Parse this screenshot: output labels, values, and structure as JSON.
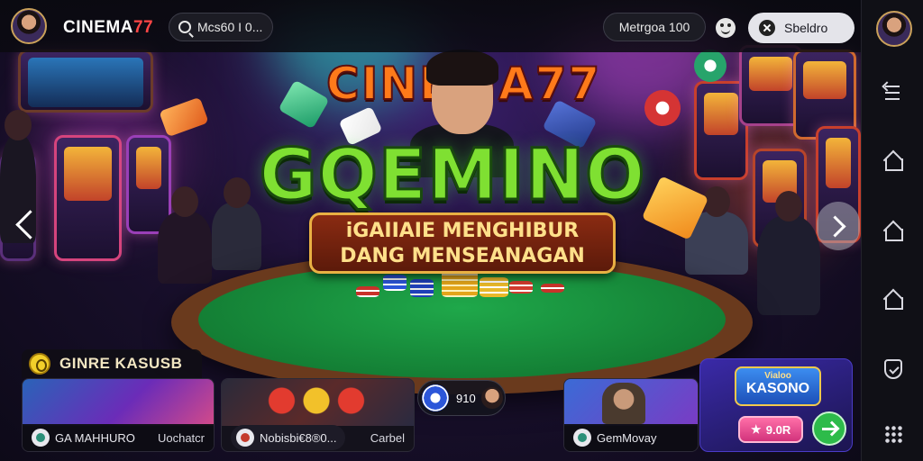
{
  "topbar": {
    "logo_main": "CINEMA",
    "logo_accent": "77",
    "search_placeholder": "Mcs60 I 0...",
    "language_pill": "Metrgoa 100",
    "login_label": "Sbeldro"
  },
  "hero": {
    "brand": "CINEMA77",
    "game_title": "GQEMINO",
    "subtitle_line1": "iGAIIAIE MENGHIBUR",
    "subtitle_line2": "DANG MENSEANAGAN"
  },
  "categories": {
    "section_title": "GINRE KASUSB",
    "cards": [
      {
        "name": "GA MAHHURO",
        "secondary": "Uochatcr"
      },
      {
        "name": "Nobisbi€8®0...",
        "secondary": "Carbel"
      },
      {
        "name": "GemMovay",
        "secondary": ""
      }
    ],
    "mini_pill_label": "910"
  },
  "promo": {
    "logo_small": "Vialoo",
    "logo_big": "KASONO",
    "price": "9.0R"
  },
  "colors": {
    "accent_red": "#ff4646",
    "title_green": "#7fe032",
    "promo_pink": "#d2337c",
    "go_green": "#2dbb4a"
  },
  "sidebar_icons": [
    "history-icon",
    "home-icon",
    "home-icon",
    "home-icon",
    "shield-icon",
    "grid-icon"
  ]
}
